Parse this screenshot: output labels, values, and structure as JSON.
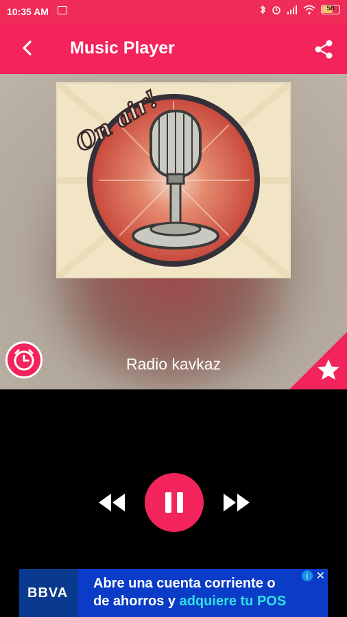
{
  "status_bar": {
    "time": "10:35 AM",
    "battery": "58"
  },
  "app_bar": {
    "title": "Music Player",
    "back_icon": "back-arrow-icon",
    "share_icon": "share-icon"
  },
  "artwork": {
    "badge_text": "On air!"
  },
  "station": {
    "name": "Radio kavkaz"
  },
  "controls": {
    "rewind": "rewind-icon",
    "pause": "pause-icon",
    "forward": "fast-forward-icon",
    "accent": "#f3245b"
  },
  "ad": {
    "brand": "BBVA",
    "line1": "Abre una cuenta corriente o",
    "line2_plain": "de ahorros y ",
    "line2_highlight": "adquiere tu POS"
  }
}
